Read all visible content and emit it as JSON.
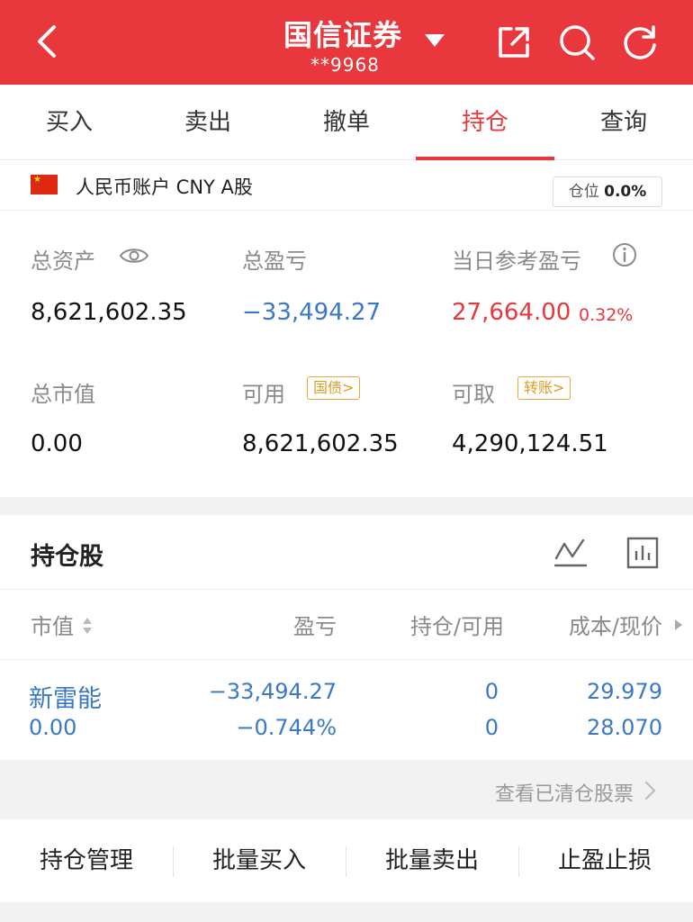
{
  "header": {
    "title": "国信证券",
    "account_masked": "**9968",
    "icons": [
      "back-arrow-icon",
      "caret-down-icon",
      "share-icon",
      "search-icon",
      "refresh-icon"
    ]
  },
  "tabs": [
    {
      "label": "买入",
      "active": false
    },
    {
      "label": "卖出",
      "active": false
    },
    {
      "label": "撤单",
      "active": false
    },
    {
      "label": "持仓",
      "active": true
    },
    {
      "label": "查询",
      "active": false
    }
  ],
  "account": {
    "label": "人民币账户 CNY A股",
    "position_label": "仓位",
    "position_value": "0.0%",
    "total_assets_label": "总资产",
    "total_assets": "8,621,602.35",
    "total_pnl_label": "总盈亏",
    "total_pnl": "−33,494.27",
    "daily_pnl_label": "当日参考盈亏",
    "daily_pnl": "27,664.00",
    "daily_pnl_pct": "0.32%",
    "market_value_label": "总市值",
    "market_value": "0.00",
    "available_label": "可用",
    "available_chip": "国债>",
    "available": "8,621,602.35",
    "withdrawable_label": "可取",
    "withdrawable_chip": "转账>",
    "withdrawable": "4,290,124.51"
  },
  "holdings": {
    "title": "持仓股",
    "columns": [
      "市值",
      "盈亏",
      "持仓/可用",
      "成本/现价"
    ],
    "rows": [
      {
        "name": "新雷能",
        "market_value": "0.00",
        "pnl": "−33,494.27",
        "pnl_pct": "−0.744%",
        "position": "0",
        "available": "0",
        "cost": "29.979",
        "price": "28.070"
      }
    ]
  },
  "cleared_link": "查看已清仓股票",
  "actions": [
    "持仓管理",
    "批量买入",
    "批量卖出",
    "止盈止损"
  ],
  "colors": {
    "brand_red": "#e8373d",
    "positive_red": "#e8373d",
    "negative_blue": "#3a78c8",
    "chip_orange": "#e09a20"
  }
}
